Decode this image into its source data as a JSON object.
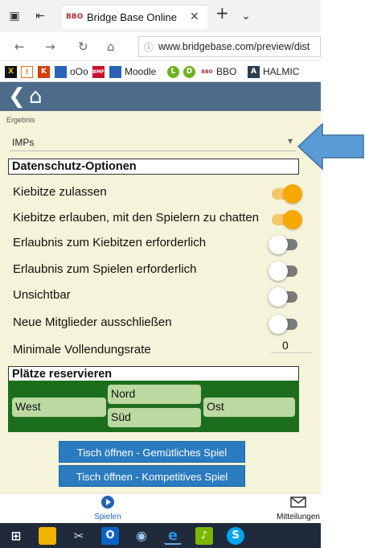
{
  "browser": {
    "tab_title": "Bridge Base Online",
    "tab_favicon": "BBO",
    "url": "www.bridgebase.com/preview/dist",
    "favorites": [
      {
        "label": "",
        "color": "#c8102e",
        "glyph": "X"
      },
      {
        "label": "",
        "color": "#e4761b",
        "glyph": "!"
      },
      {
        "label": "",
        "color": "#d43f00",
        "glyph": "K"
      },
      {
        "label": "oOo",
        "color": "#2a62b8",
        "glyph": ""
      },
      {
        "label": "",
        "color": "#c8102e",
        "glyph": "BMF"
      },
      {
        "label": "Moodle",
        "color": "#2a62b8",
        "glyph": ""
      },
      {
        "label": "",
        "color": "#6fb11f",
        "glyph": "L"
      },
      {
        "label": "",
        "color": "#6fb11f",
        "glyph": "D"
      },
      {
        "label": "BBO",
        "color": "#a33",
        "glyph": "BBO"
      },
      {
        "label": "HALMIC",
        "color": "#2c3e50",
        "glyph": "A"
      }
    ]
  },
  "app": {
    "result_label": "Ergebnis",
    "result_value": "IMPs",
    "privacy_title": "Datenschutz-Optionen",
    "options": [
      {
        "label": "Kiebitze zulassen",
        "on": true
      },
      {
        "label": "Kiebitze erlauben, mit den Spielern zu chatten",
        "on": true
      },
      {
        "label": "Erlaubnis zum Kiebitzen erforderlich",
        "on": false
      },
      {
        "label": "Erlaubnis zum Spielen erforderlich",
        "on": false
      },
      {
        "label": "Unsichtbar",
        "on": false
      },
      {
        "label": "Neue Mitglieder ausschließen",
        "on": false
      }
    ],
    "min_rate_label": "Minimale Vollendungsrate",
    "min_rate_value": "0",
    "seats_title": "Plätze reservieren",
    "seats": {
      "north": "Nord",
      "south": "Süd",
      "west": "West",
      "east": "Ost"
    },
    "button_casual": "Tisch öffnen - Gemütliches Spiel",
    "button_competitive": "Tisch öffnen - Kompetitives Spiel",
    "arrow_color": "#5b9bd5"
  },
  "bottom_nav": {
    "play": "Spielen",
    "messages": "Mitteilungen"
  },
  "taskbar": [
    {
      "name": "windows-start-icon",
      "color": "#1f2a3a",
      "glyph": "⊞"
    },
    {
      "name": "file-explorer-icon",
      "color": "#f0b400",
      "glyph": ""
    },
    {
      "name": "snipping-tool-icon",
      "color": "#1f2a3a",
      "glyph": "✂"
    },
    {
      "name": "outlook-icon",
      "color": "#0a64c8",
      "glyph": "O"
    },
    {
      "name": "globe-app-icon",
      "color": "#2d6bb5",
      "glyph": "◉"
    },
    {
      "name": "edge-icon",
      "color": "#1f2a3a",
      "glyph": "e"
    },
    {
      "name": "music-app-icon",
      "color": "#7ab800",
      "glyph": "♪"
    },
    {
      "name": "skype-icon",
      "color": "#00a4ef",
      "glyph": "S"
    }
  ]
}
